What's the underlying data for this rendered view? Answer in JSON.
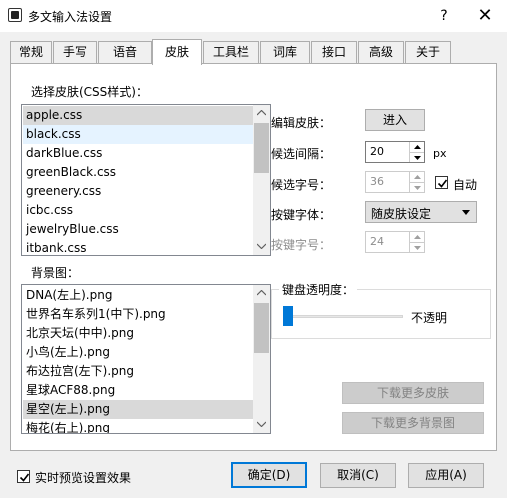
{
  "window": {
    "title": "多文输入法设置",
    "help_glyph": "?",
    "close_glyph": "✕"
  },
  "tabs": [
    {
      "label": "常规"
    },
    {
      "label": "手写"
    },
    {
      "label": "语音"
    },
    {
      "label": "皮肤"
    },
    {
      "label": "工具栏"
    },
    {
      "label": "词库"
    },
    {
      "label": "接口"
    },
    {
      "label": "高级"
    },
    {
      "label": "关于"
    }
  ],
  "selected_tab": "皮肤",
  "skin_section": {
    "label": "选择皮肤(CSS样式)：",
    "items": [
      "apple.css",
      "black.css",
      "darkBlue.css",
      "greenBlack.css",
      "greenery.css",
      "icbc.css",
      "jewelryBlue.css",
      "itbank.css"
    ],
    "selected": "apple.css",
    "highlighted": "black.css"
  },
  "background_section": {
    "label": "背景图：",
    "items": [
      "DNA(左上).png",
      "世界名车系列1(中下).png",
      "北京天坛(中中).png",
      "小鸟(左上).png",
      "布达拉宫(左下).png",
      "星球ACF88.png",
      "星空(左上).png",
      "梅花(右上).png"
    ],
    "selected": "星空(左上).png"
  },
  "settings": {
    "edit_skin_label": "编辑皮肤：",
    "enter_button": "进入",
    "candidate_spacing_label": "候选间隔：",
    "candidate_spacing_value": "20",
    "candidate_spacing_unit": "px",
    "candidate_font_size_label": "候选字号：",
    "candidate_font_size_value": "36",
    "auto_label": "自动",
    "auto_checked": true,
    "key_font_label": "按键字体：",
    "key_font_value": "随皮肤设定",
    "key_font_size_label": "按键字号：",
    "key_font_size_value": "24"
  },
  "opacity": {
    "label": "键盘透明度：",
    "value_text": "不透明",
    "slider_level": 0
  },
  "download_buttons": {
    "more_skins": "下载更多皮肤",
    "more_backgrounds": "下载更多背景图"
  },
  "footer": {
    "realtime_preview_label": "实时预览设置效果",
    "realtime_preview_checked": true,
    "ok_button": "确定(D)",
    "cancel_button": "取消(C)",
    "apply_button": "应用(A)"
  },
  "colors": {
    "accent": "#0078d7",
    "selection_gray": "#d9d9d9",
    "hover_blue": "#e5f3ff"
  }
}
